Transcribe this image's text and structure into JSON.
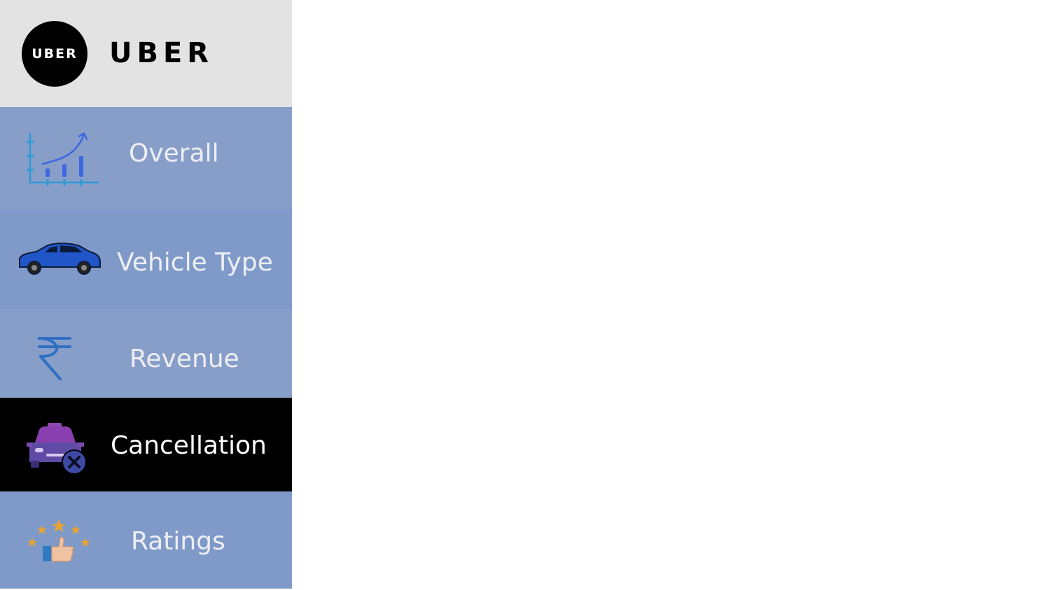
{
  "brand": {
    "logo_text": "UBER",
    "name": "UBER"
  },
  "nav": {
    "items": [
      {
        "label": "Overall",
        "icon": "chart-growth-icon"
      },
      {
        "label": "Vehicle Type",
        "icon": "car-icon"
      },
      {
        "label": "Revenue",
        "icon": "rupee-icon"
      },
      {
        "label": "Cancellation",
        "icon": "taxi-cancel-icon",
        "active": true
      },
      {
        "label": "Ratings",
        "icon": "thumbs-up-stars-icon"
      }
    ]
  },
  "colors": {
    "brand_bg": "#e3e3e3",
    "nav_bg": "#879ec9",
    "nav_bg_alt": "#7f9ac8",
    "active_bg": "#000000",
    "label_text": "#eeeef3"
  }
}
